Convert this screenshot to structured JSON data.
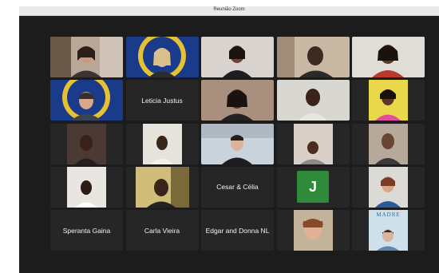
{
  "window": {
    "title": "Reunião Zoom"
  },
  "participants": [
    {
      "name": "",
      "video": true
    },
    {
      "name": "",
      "video": true
    },
    {
      "name": "",
      "video": true
    },
    {
      "name": "",
      "video": true
    },
    {
      "name": "",
      "video": true,
      "active": true
    },
    {
      "name": "",
      "video": true
    },
    {
      "name": "Leticia Justus",
      "video": false
    },
    {
      "name": "",
      "video": true
    },
    {
      "name": "",
      "video": true
    },
    {
      "name": "",
      "video": true
    },
    {
      "name": "",
      "video": true
    },
    {
      "name": "",
      "video": true
    },
    {
      "name": "",
      "video": true
    },
    {
      "name": "",
      "video": true
    },
    {
      "name": "",
      "video": true
    },
    {
      "name": "",
      "video": true
    },
    {
      "name": "",
      "video": true
    },
    {
      "name": "Cesar & Célia",
      "video": false
    },
    {
      "name": "",
      "video": false,
      "avatar_letter": "J"
    },
    {
      "name": "",
      "video": true
    },
    {
      "name": "Speranta Gaina",
      "video": false
    },
    {
      "name": "Carla Vieira",
      "video": false
    },
    {
      "name": "Edgar and Donna NL",
      "video": false
    },
    {
      "name": "",
      "video": true
    },
    {
      "name": "",
      "video": true,
      "book_title": "MADRE"
    }
  ],
  "colors": {
    "active_speaker": "#4fd65a",
    "tile_bg": "#262626",
    "window_bg": "#1c1c1c",
    "avatar_j": "#2f8a3a"
  }
}
